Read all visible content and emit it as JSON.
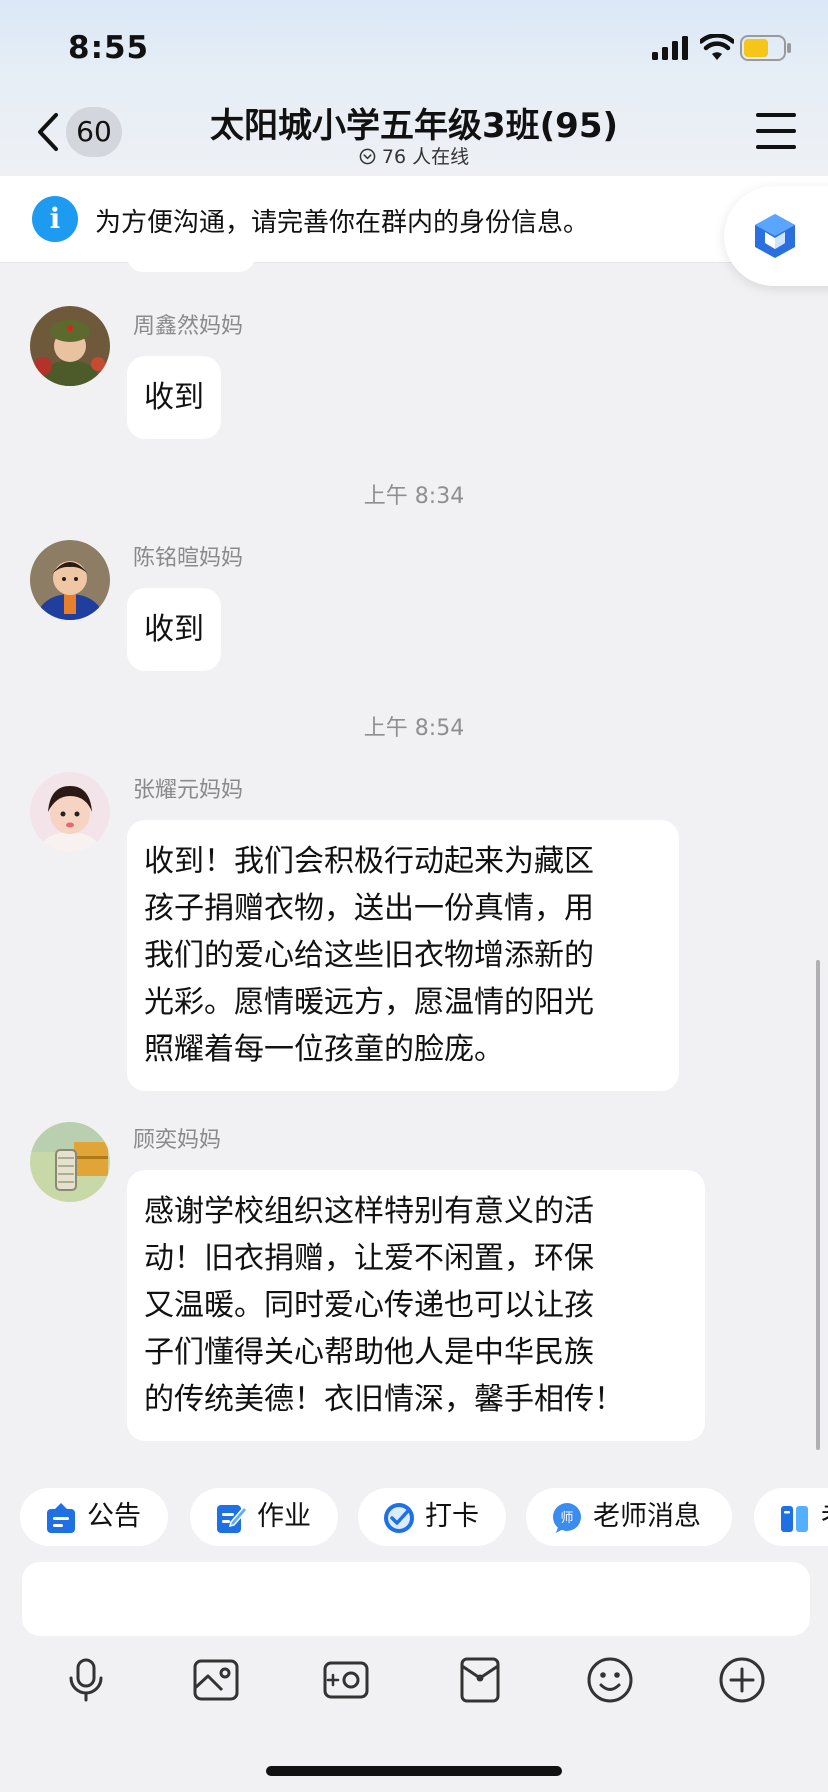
{
  "status_bar": {
    "time": "8:55"
  },
  "header": {
    "back_count": "60",
    "title": "太阳城小学五年级3班(95)",
    "online": "76 人在线"
  },
  "notice": {
    "text": "为方便沟通，请完善你在群内的身份信息。"
  },
  "messages": [
    {
      "type": "text",
      "sender": "周鑫然妈妈",
      "text": "收到"
    },
    {
      "type": "time",
      "text": "上午 8:34"
    },
    {
      "type": "text",
      "sender": "陈铭暄妈妈",
      "text": "收到"
    },
    {
      "type": "time",
      "text": "上午 8:54"
    },
    {
      "type": "text",
      "sender": "张耀元妈妈",
      "lines": [
        "收到！我们会积极行动起来为藏区",
        "孩子捐赠衣物，送出一份真情，用",
        "我们的爱心给这些旧衣物增添新的",
        "光彩。愿情暖远方，愿温情的阳光",
        "照耀着每一位孩童的脸庞。"
      ]
    },
    {
      "type": "text",
      "sender": "顾奕妈妈",
      "lines": [
        "感谢学校组织这样特别有意义的活",
        "动！旧衣捐赠，让爱不闲置，环保",
        "又温暖。同时爱心传递也可以让孩",
        "子们懂得关心帮助他人是中华民族",
        "的传统美德！衣旧情深，馨手相传！"
      ]
    }
  ],
  "shortcuts": [
    {
      "label": "公告",
      "icon": "announcement-icon"
    },
    {
      "label": "作业",
      "icon": "homework-icon"
    },
    {
      "label": "打卡",
      "icon": "check-in-icon"
    },
    {
      "label": "老师消息",
      "icon": "teacher-message-icon"
    },
    {
      "label": "老",
      "icon": "book-icon"
    }
  ],
  "toolbar": [
    "microphone-icon",
    "image-icon",
    "camera-icon",
    "red-packet-icon",
    "emoji-icon",
    "plus-icon"
  ],
  "colors": {
    "accent": "#1d9bf0",
    "background": "#f1f1f3",
    "bubble": "#ffffff"
  }
}
